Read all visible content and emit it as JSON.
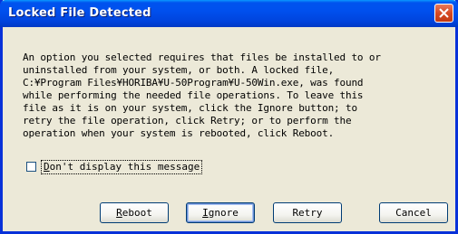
{
  "window": {
    "title": "Locked File Detected"
  },
  "message": {
    "lines": [
      "An option you selected requires that files be installed to or",
      "uninstalled from your system, or both. A locked file,",
      "C:¥Program Files¥HORIBA¥U-50Program¥U-50Win.exe, was found",
      "while performing the needed file operations. To leave this",
      "file as it is on your system, click the Ignore button; to",
      "retry the file operation, click Retry; or to perform the",
      "operation when your system is rebooted, click Reboot."
    ]
  },
  "checkbox": {
    "label": "Don't display this message",
    "checked": false
  },
  "buttons": {
    "reboot": {
      "mnemonic": "R",
      "rest": "eboot"
    },
    "ignore": {
      "mnemonic": "I",
      "rest": "gnore"
    },
    "retry": "Retry",
    "cancel": "Cancel",
    "default": "ignore"
  },
  "colors": {
    "titlebar": "#0050ee",
    "dialog_background": "#ece9d8",
    "close_button": "#d64a24"
  },
  "icons": {
    "close": "close-x-icon"
  }
}
